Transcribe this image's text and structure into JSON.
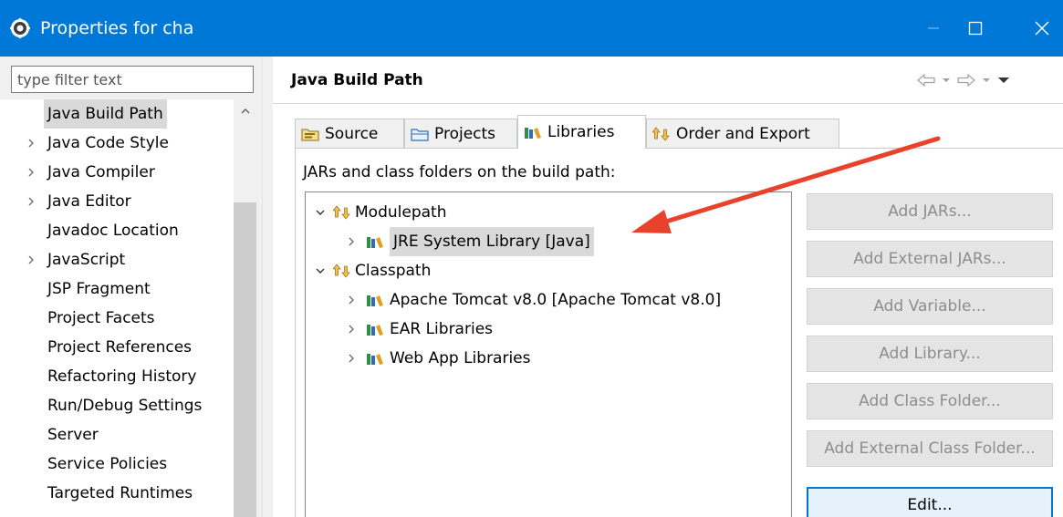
{
  "window": {
    "title": "Properties for cha"
  },
  "sidebar": {
    "filter_placeholder": "type filter text",
    "items": [
      {
        "label": "Java Build Path",
        "expandable": false,
        "selected": true
      },
      {
        "label": "Java Code Style",
        "expandable": true
      },
      {
        "label": "Java Compiler",
        "expandable": true
      },
      {
        "label": "Java Editor",
        "expandable": true
      },
      {
        "label": "Javadoc Location",
        "expandable": false
      },
      {
        "label": "JavaScript",
        "expandable": true
      },
      {
        "label": "JSP Fragment",
        "expandable": false
      },
      {
        "label": "Project Facets",
        "expandable": false
      },
      {
        "label": "Project References",
        "expandable": false
      },
      {
        "label": "Refactoring History",
        "expandable": false
      },
      {
        "label": "Run/Debug Settings",
        "expandable": false
      },
      {
        "label": "Server",
        "expandable": false
      },
      {
        "label": "Service Policies",
        "expandable": false
      },
      {
        "label": "Targeted Runtimes",
        "expandable": false
      }
    ]
  },
  "main": {
    "title": "Java Build Path",
    "tabs": [
      {
        "label": "Source",
        "icon": "source-folder-icon"
      },
      {
        "label": "Projects",
        "icon": "projects-folder-icon"
      },
      {
        "label": "Libraries",
        "icon": "libraries-icon",
        "active": true
      },
      {
        "label": "Order and Export",
        "icon": "order-export-icon"
      }
    ],
    "caption": "JARs and class folders on the build path:",
    "tree": {
      "modulepath": {
        "label": "Modulepath",
        "children": [
          "JRE System Library [Java]"
        ]
      },
      "classpath": {
        "label": "Classpath",
        "children": [
          "Apache Tomcat v8.0 [Apache Tomcat v8.0]",
          "EAR Libraries",
          "Web App Libraries"
        ]
      }
    },
    "buttons": {
      "add_jars": "Add JARs...",
      "add_external_jars": "Add External JARs...",
      "add_variable": "Add Variable...",
      "add_library": "Add Library...",
      "add_class_folder": "Add Class Folder...",
      "add_external_class_folder": "Add External Class Folder...",
      "edit": "Edit..."
    }
  },
  "colors": {
    "titlebar": "#0078d7",
    "selection": "#d9d9d9",
    "annotation_arrow": "#e8412c"
  }
}
